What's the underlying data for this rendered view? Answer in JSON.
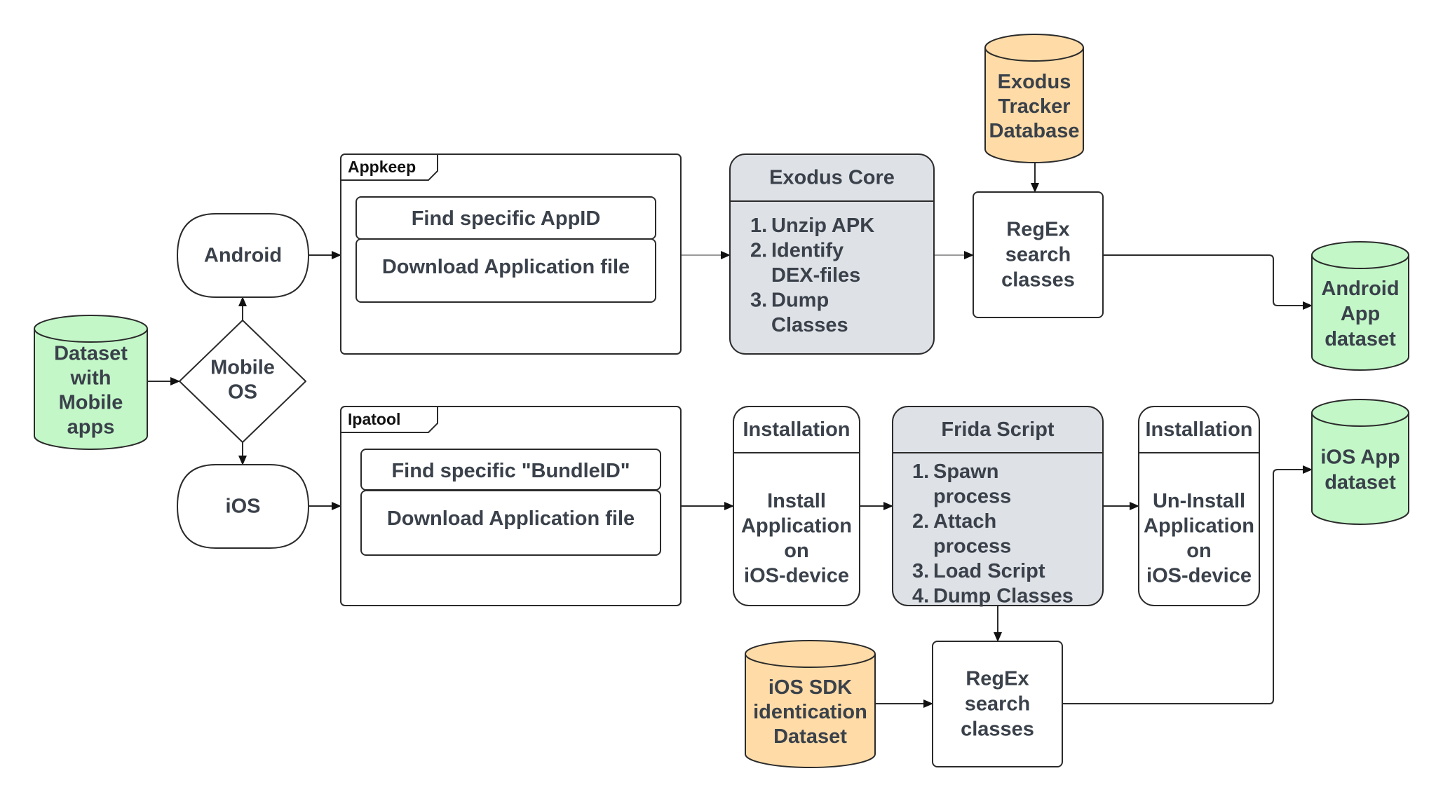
{
  "colors": {
    "dataset_green": "#c3f7c8",
    "database_orange": "#fedba7",
    "process_grey": "#dee1e6",
    "text": "#3a414a",
    "stroke": "#2b2b2b"
  },
  "nodes": {
    "dataset_mobile": {
      "lines": [
        "Dataset",
        "with",
        "Mobile",
        "apps"
      ]
    },
    "mobile_os": {
      "lines": [
        "Mobile",
        "OS"
      ]
    },
    "android": {
      "lines": [
        "Android"
      ]
    },
    "ios": {
      "lines": [
        "iOS"
      ]
    },
    "appkeep": {
      "title": "Appkeep",
      "steps": [
        "Find specific AppID",
        "Download Application file"
      ]
    },
    "ipatool": {
      "title": "Ipatool",
      "steps": [
        "Find specific \"BundleID\"",
        "Download Application file"
      ]
    },
    "exodus_core": {
      "title": "Exodus Core",
      "items": [
        {
          "num": "1.",
          "lines": [
            "Unzip APK"
          ]
        },
        {
          "num": "2.",
          "lines": [
            "Identify",
            "DEX-files"
          ]
        },
        {
          "num": "3.",
          "lines": [
            "Dump",
            "Classes"
          ]
        }
      ]
    },
    "exodus_db": {
      "lines": [
        "Exodus",
        "Tracker",
        "Database"
      ]
    },
    "regex_android": {
      "lines": [
        "RegEx",
        "search",
        "classes"
      ]
    },
    "android_dataset": {
      "lines": [
        "Android",
        "App",
        "dataset"
      ]
    },
    "install": {
      "title": "Installation",
      "lines": [
        "Install",
        "Application",
        "on",
        "iOS-device"
      ]
    },
    "frida": {
      "title": "Frida Script",
      "items": [
        {
          "num": "1.",
          "lines": [
            "Spawn",
            "process"
          ]
        },
        {
          "num": "2.",
          "lines": [
            "Attach",
            "process"
          ]
        },
        {
          "num": "3.",
          "lines": [
            "Load Script"
          ]
        },
        {
          "num": "4.",
          "lines": [
            "Dump Classes"
          ]
        }
      ]
    },
    "uninstall": {
      "title": "Installation",
      "lines": [
        "Un-Install",
        "Application",
        "on",
        "iOS-device"
      ]
    },
    "ios_dataset": {
      "lines": [
        "iOS App",
        "dataset"
      ]
    },
    "ios_sdk_db": {
      "lines": [
        "iOS SDK",
        "identication",
        "Dataset"
      ]
    },
    "regex_ios": {
      "lines": [
        "RegEx",
        "search",
        "classes"
      ]
    }
  },
  "edges": [
    {
      "from": "dataset_mobile",
      "to": "mobile_os"
    },
    {
      "from": "mobile_os",
      "to": "android"
    },
    {
      "from": "mobile_os",
      "to": "ios"
    },
    {
      "from": "android",
      "to": "appkeep"
    },
    {
      "from": "ios",
      "to": "ipatool"
    },
    {
      "from": "appkeep",
      "to": "exodus_core"
    },
    {
      "from": "exodus_core",
      "to": "regex_android"
    },
    {
      "from": "exodus_db",
      "to": "regex_android"
    },
    {
      "from": "regex_android",
      "to": "android_dataset"
    },
    {
      "from": "ipatool",
      "to": "install"
    },
    {
      "from": "install",
      "to": "frida"
    },
    {
      "from": "frida",
      "to": "uninstall"
    },
    {
      "from": "frida",
      "to": "regex_ios"
    },
    {
      "from": "ios_sdk_db",
      "to": "regex_ios"
    },
    {
      "from": "regex_ios",
      "to": "ios_dataset"
    }
  ]
}
